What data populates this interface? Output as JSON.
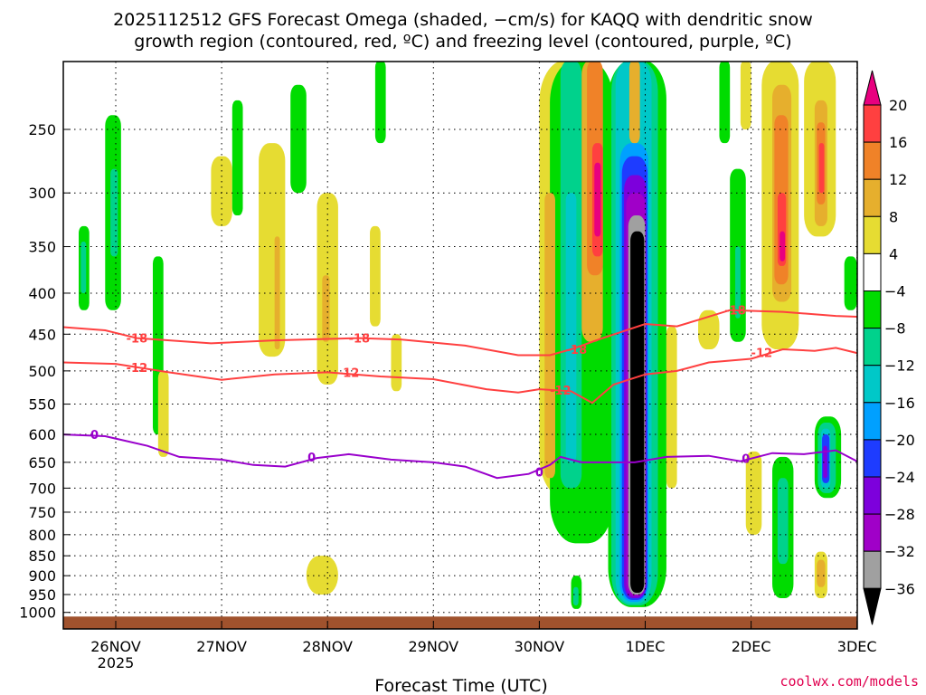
{
  "chart_data": {
    "type": "heatmap",
    "title_line1": "2025112512 GFS Forecast Omega (shaded, −cm/s) for KAQQ with dendritic snow",
    "title_line2": "growth region (contoured, red, ºC) and freezing level (contoured, purple, ºC)",
    "xlabel": "Forecast Time (UTC)",
    "ylabel": "",
    "credit": "coolwx.com/models",
    "x_unit": "days after 26NOV2025 00Z",
    "xlim": [
      -0.5,
      7.0
    ],
    "ylim_hPa": [
      205,
      1050
    ],
    "y_scale": "log",
    "grid": true,
    "x_ticks": [
      {
        "t": 0,
        "label": "26NOV",
        "sub": "2025"
      },
      {
        "t": 1,
        "label": "27NOV"
      },
      {
        "t": 2,
        "label": "28NOV"
      },
      {
        "t": 3,
        "label": "29NOV"
      },
      {
        "t": 4,
        "label": "30NOV"
      },
      {
        "t": 5,
        "label": "1DEC"
      },
      {
        "t": 6,
        "label": "2DEC"
      },
      {
        "t": 7,
        "label": "3DEC"
      }
    ],
    "y_ticks": [
      250,
      300,
      350,
      400,
      450,
      500,
      550,
      600,
      650,
      700,
      750,
      800,
      850,
      900,
      950,
      1000
    ],
    "colorbar": {
      "labels": [
        "20",
        "16",
        "12",
        "8",
        "4",
        "−4",
        "−8",
        "−12",
        "−16",
        "−20",
        "−24",
        "−28",
        "−32",
        "−36"
      ],
      "over_color": "#e8007f",
      "under_color": "#000000",
      "colors": [
        "#ff4040",
        "#f08228",
        "#e6af2d",
        "#e6dc32",
        "#ffffff",
        "#00dc00",
        "#00d28c",
        "#00c8c8",
        "#00a0ff",
        "#1e3cff",
        "#7d00dc",
        "#a000c8",
        "#a0a0a0"
      ]
    },
    "palette": {
      "mag": "#e8007f",
      "red": "#ff4040",
      "org": "#f08228",
      "gold": "#e6af2d",
      "yel": "#e6dc32",
      "grn": "#00dc00",
      "teal": "#00d28c",
      "cyan": "#00c8c8",
      "lblu": "#00a0ff",
      "blue": "#1e3cff",
      "purp": "#7d00dc",
      "viol": "#a000c8",
      "gray": "#a0a0a0",
      "blk": "#000000"
    },
    "omega_patches": [
      {
        "t": [
          -0.35,
          -0.25
        ],
        "p": [
          330,
          420
        ],
        "c": "grn"
      },
      {
        "t": [
          -0.33,
          -0.28
        ],
        "p": [
          345,
          400
        ],
        "c": "teal"
      },
      {
        "t": [
          -0.1,
          0.05
        ],
        "p": [
          240,
          420
        ],
        "c": "grn"
      },
      {
        "t": [
          -0.05,
          0.02
        ],
        "p": [
          280,
          360
        ],
        "c": "teal"
      },
      {
        "t": [
          0.35,
          0.45
        ],
        "p": [
          360,
          600
        ],
        "c": "grn"
      },
      {
        "t": [
          0.4,
          0.5
        ],
        "p": [
          500,
          640
        ],
        "c": "yel"
      },
      {
        "t": [
          0.9,
          1.1
        ],
        "p": [
          270,
          330
        ],
        "c": "yel"
      },
      {
        "t": [
          1.1,
          1.2
        ],
        "p": [
          230,
          320
        ],
        "c": "grn"
      },
      {
        "t": [
          1.35,
          1.6
        ],
        "p": [
          260,
          480
        ],
        "c": "yel"
      },
      {
        "t": [
          1.5,
          1.55
        ],
        "p": [
          340,
          470
        ],
        "c": "gold"
      },
      {
        "t": [
          1.65,
          1.8
        ],
        "p": [
          220,
          300
        ],
        "c": "grn"
      },
      {
        "t": [
          1.9,
          2.1
        ],
        "p": [
          300,
          520
        ],
        "c": "yel"
      },
      {
        "t": [
          1.95,
          2.02
        ],
        "p": [
          380,
          460
        ],
        "c": "gold"
      },
      {
        "t": [
          2.4,
          2.5
        ],
        "p": [
          330,
          440
        ],
        "c": "yel"
      },
      {
        "t": [
          2.6,
          2.7
        ],
        "p": [
          450,
          530
        ],
        "c": "yel"
      },
      {
        "t": [
          1.8,
          2.1
        ],
        "p": [
          850,
          950
        ],
        "c": "yel"
      },
      {
        "t": [
          2.45,
          2.55
        ],
        "p": [
          205,
          260
        ],
        "c": "grn"
      },
      {
        "t": [
          4.0,
          4.6
        ],
        "p": [
          205,
          720
        ],
        "c": "yel"
      },
      {
        "t": [
          4.1,
          4.7
        ],
        "p": [
          205,
          820
        ],
        "c": "grn"
      },
      {
        "t": [
          4.2,
          4.4
        ],
        "p": [
          205,
          700
        ],
        "c": "teal"
      },
      {
        "t": [
          4.25,
          4.35
        ],
        "p": [
          300,
          650
        ],
        "c": "cyan"
      },
      {
        "t": [
          4.05,
          4.15
        ],
        "p": [
          300,
          680
        ],
        "c": "gold"
      },
      {
        "t": [
          4.4,
          4.6
        ],
        "p": [
          205,
          460
        ],
        "c": "gold"
      },
      {
        "t": [
          4.45,
          4.6
        ],
        "p": [
          205,
          380
        ],
        "c": "org"
      },
      {
        "t": [
          4.5,
          4.6
        ],
        "p": [
          260,
          360
        ],
        "c": "red"
      },
      {
        "t": [
          4.52,
          4.58
        ],
        "p": [
          275,
          340
        ],
        "c": "mag"
      },
      {
        "t": [
          4.3,
          4.4
        ],
        "p": [
          900,
          990
        ],
        "c": "grn"
      },
      {
        "t": [
          4.32,
          4.37
        ],
        "p": [
          930,
          980
        ],
        "c": "teal"
      },
      {
        "t": [
          4.65,
          5.2
        ],
        "p": [
          205,
          985
        ],
        "c": "grn"
      },
      {
        "t": [
          4.68,
          5.12
        ],
        "p": [
          205,
          980
        ],
        "c": "teal"
      },
      {
        "t": [
          4.72,
          5.06
        ],
        "p": [
          205,
          975
        ],
        "c": "cyan"
      },
      {
        "t": [
          4.76,
          5.03
        ],
        "p": [
          260,
          970
        ],
        "c": "lblu"
      },
      {
        "t": [
          4.78,
          5.02
        ],
        "p": [
          270,
          965
        ],
        "c": "blue"
      },
      {
        "t": [
          4.8,
          5.01
        ],
        "p": [
          285,
          960
        ],
        "c": "purp"
      },
      {
        "t": [
          4.82,
          5.0
        ],
        "p": [
          300,
          955
        ],
        "c": "viol"
      },
      {
        "t": [
          4.84,
          5.0
        ],
        "p": [
          320,
          950
        ],
        "c": "gray"
      },
      {
        "t": [
          4.86,
          4.99
        ],
        "p": [
          335,
          945
        ],
        "c": "blk"
      },
      {
        "t": [
          4.85,
          4.95
        ],
        "p": [
          205,
          260
        ],
        "c": "gold"
      },
      {
        "t": [
          5.2,
          5.3
        ],
        "p": [
          440,
          700
        ],
        "c": "yel"
      },
      {
        "t": [
          5.5,
          5.7
        ],
        "p": [
          420,
          470
        ],
        "c": "yel"
      },
      {
        "t": [
          5.7,
          5.8
        ],
        "p": [
          205,
          260
        ],
        "c": "grn"
      },
      {
        "t": [
          5.8,
          5.95
        ],
        "p": [
          280,
          460
        ],
        "c": "grn"
      },
      {
        "t": [
          5.85,
          5.9
        ],
        "p": [
          350,
          430
        ],
        "c": "teal"
      },
      {
        "t": [
          5.9,
          6.0
        ],
        "p": [
          205,
          250
        ],
        "c": "yel"
      },
      {
        "t": [
          5.95,
          6.1
        ],
        "p": [
          630,
          800
        ],
        "c": "yel"
      },
      {
        "t": [
          6.1,
          6.45
        ],
        "p": [
          205,
          470
        ],
        "c": "yel"
      },
      {
        "t": [
          6.2,
          6.38
        ],
        "p": [
          220,
          410
        ],
        "c": "gold"
      },
      {
        "t": [
          6.22,
          6.35
        ],
        "p": [
          240,
          390
        ],
        "c": "org"
      },
      {
        "t": [
          6.25,
          6.33
        ],
        "p": [
          300,
          370
        ],
        "c": "red"
      },
      {
        "t": [
          6.27,
          6.32
        ],
        "p": [
          335,
          365
        ],
        "c": "mag"
      },
      {
        "t": [
          6.2,
          6.4
        ],
        "p": [
          640,
          960
        ],
        "c": "grn"
      },
      {
        "t": [
          6.25,
          6.35
        ],
        "p": [
          680,
          870
        ],
        "c": "teal"
      },
      {
        "t": [
          6.5,
          6.8
        ],
        "p": [
          205,
          340
        ],
        "c": "yel"
      },
      {
        "t": [
          6.6,
          6.72
        ],
        "p": [
          230,
          330
        ],
        "c": "gold"
      },
      {
        "t": [
          6.62,
          6.7
        ],
        "p": [
          245,
          310
        ],
        "c": "org"
      },
      {
        "t": [
          6.64,
          6.69
        ],
        "p": [
          260,
          300
        ],
        "c": "red"
      },
      {
        "t": [
          6.6,
          6.85
        ],
        "p": [
          570,
          720
        ],
        "c": "grn"
      },
      {
        "t": [
          6.63,
          6.8
        ],
        "p": [
          580,
          710
        ],
        "c": "teal"
      },
      {
        "t": [
          6.66,
          6.75
        ],
        "p": [
          590,
          700
        ],
        "c": "cyan"
      },
      {
        "t": [
          6.67,
          6.74
        ],
        "p": [
          600,
          690
        ],
        "c": "blue"
      },
      {
        "t": [
          6.68,
          6.72
        ],
        "p": [
          620,
          680
        ],
        "c": "purp"
      },
      {
        "t": [
          6.6,
          6.72
        ],
        "p": [
          840,
          960
        ],
        "c": "yel"
      },
      {
        "t": [
          6.62,
          6.7
        ],
        "p": [
          860,
          930
        ],
        "c": "gold"
      },
      {
        "t": [
          6.88,
          7.0
        ],
        "p": [
          360,
          420
        ],
        "c": "grn"
      }
    ],
    "series": [
      {
        "name": "-18",
        "color": "#ff4040",
        "label_at": [
          [
            0.2,
            455
          ],
          [
            2.3,
            455
          ],
          [
            4.35,
            470
          ],
          [
            5.85,
            420
          ]
        ],
        "points": [
          [
            -0.5,
            441
          ],
          [
            -0.1,
            445
          ],
          [
            0.2,
            455
          ],
          [
            0.9,
            462
          ],
          [
            1.5,
            458
          ],
          [
            2.3,
            455
          ],
          [
            2.7,
            457
          ],
          [
            3.3,
            465
          ],
          [
            3.8,
            478
          ],
          [
            4.1,
            478
          ],
          [
            4.3,
            470
          ],
          [
            4.6,
            455
          ],
          [
            5.0,
            437
          ],
          [
            5.3,
            440
          ],
          [
            5.5,
            432
          ],
          [
            5.8,
            420
          ],
          [
            6.3,
            422
          ],
          [
            6.8,
            427
          ],
          [
            7.0,
            428
          ]
        ]
      },
      {
        "name": "-12",
        "color": "#ff4040",
        "label_at": [
          [
            0.2,
            495
          ],
          [
            2.2,
            502
          ],
          [
            4.2,
            528
          ],
          [
            6.1,
            474
          ]
        ],
        "points": [
          [
            -0.5,
            488
          ],
          [
            0,
            490
          ],
          [
            0.5,
            502
          ],
          [
            1.0,
            513
          ],
          [
            1.5,
            505
          ],
          [
            2.0,
            502
          ],
          [
            2.5,
            508
          ],
          [
            3.0,
            512
          ],
          [
            3.5,
            527
          ],
          [
            3.8,
            532
          ],
          [
            4.0,
            527
          ],
          [
            4.3,
            530
          ],
          [
            4.5,
            548
          ],
          [
            4.7,
            520
          ],
          [
            5.0,
            505
          ],
          [
            5.3,
            500
          ],
          [
            5.6,
            488
          ],
          [
            6.0,
            483
          ],
          [
            6.3,
            470
          ],
          [
            6.6,
            472
          ],
          [
            6.8,
            468
          ],
          [
            7.0,
            475
          ]
        ]
      },
      {
        "name": "0",
        "color": "#9900cc",
        "label_at": [
          [
            -0.2,
            600
          ],
          [
            1.85,
            640
          ],
          [
            4.0,
            668
          ],
          [
            5.95,
            643
          ]
        ],
        "points": [
          [
            -0.5,
            600
          ],
          [
            -0.1,
            603
          ],
          [
            0.3,
            620
          ],
          [
            0.6,
            640
          ],
          [
            1.0,
            645
          ],
          [
            1.3,
            655
          ],
          [
            1.6,
            658
          ],
          [
            1.9,
            642
          ],
          [
            2.2,
            635
          ],
          [
            2.6,
            645
          ],
          [
            3.0,
            650
          ],
          [
            3.3,
            658
          ],
          [
            3.6,
            680
          ],
          [
            3.9,
            672
          ],
          [
            4.1,
            655
          ],
          [
            4.2,
            640
          ],
          [
            4.4,
            650
          ],
          [
            4.9,
            650
          ],
          [
            5.2,
            640
          ],
          [
            5.6,
            638
          ],
          [
            5.9,
            648
          ],
          [
            6.2,
            633
          ],
          [
            6.5,
            635
          ],
          [
            6.8,
            628
          ],
          [
            7.0,
            648
          ]
        ]
      }
    ],
    "ground_hPa": 1012
  }
}
